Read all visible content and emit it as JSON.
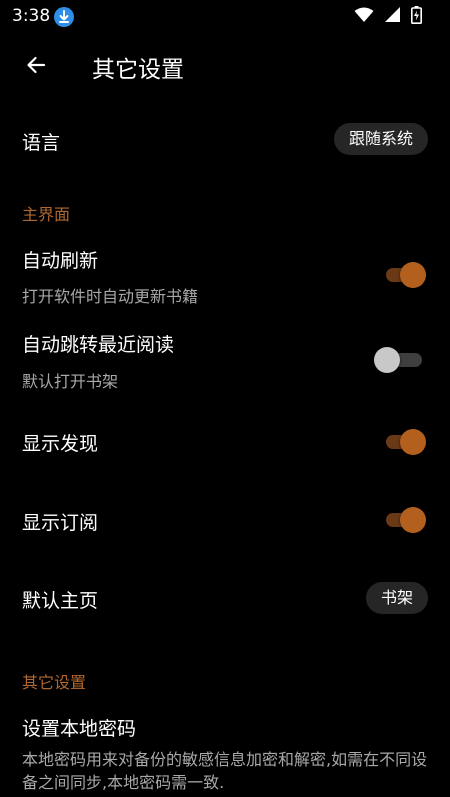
{
  "status_bar": {
    "time": "3:38",
    "download_icon": "download-icon",
    "wifi_icon": "wifi-icon",
    "signal_icon": "cell-signal-icon",
    "battery_icon": "battery-charging-icon"
  },
  "toolbar": {
    "back_icon": "arrow-left-icon",
    "title": "其它设置"
  },
  "language": {
    "title": "语言",
    "value": "跟随系统"
  },
  "sections": {
    "main_ui": "主界面",
    "other": "其它设置"
  },
  "auto_refresh": {
    "title": "自动刷新",
    "subtitle": "打开软件时自动更新书籍",
    "enabled": true
  },
  "auto_jump_recent": {
    "title": "自动跳转最近阅读",
    "subtitle": "默认打开书架",
    "enabled": false
  },
  "show_discover": {
    "title": "显示发现",
    "enabled": true
  },
  "show_subscription": {
    "title": "显示订阅",
    "enabled": true
  },
  "default_home": {
    "title": "默认主页",
    "value": "书架"
  },
  "local_password": {
    "title": "设置本地密码",
    "description": "本地密码用来对备份的敏感信息加密和解密,如需在不同设备之间同步,本地密码需一致."
  },
  "colors": {
    "accent": "#b3601f",
    "accent_track": "#6a3a17",
    "section_header": "#b06830",
    "background": "#000000",
    "chip_background": "#262626"
  }
}
